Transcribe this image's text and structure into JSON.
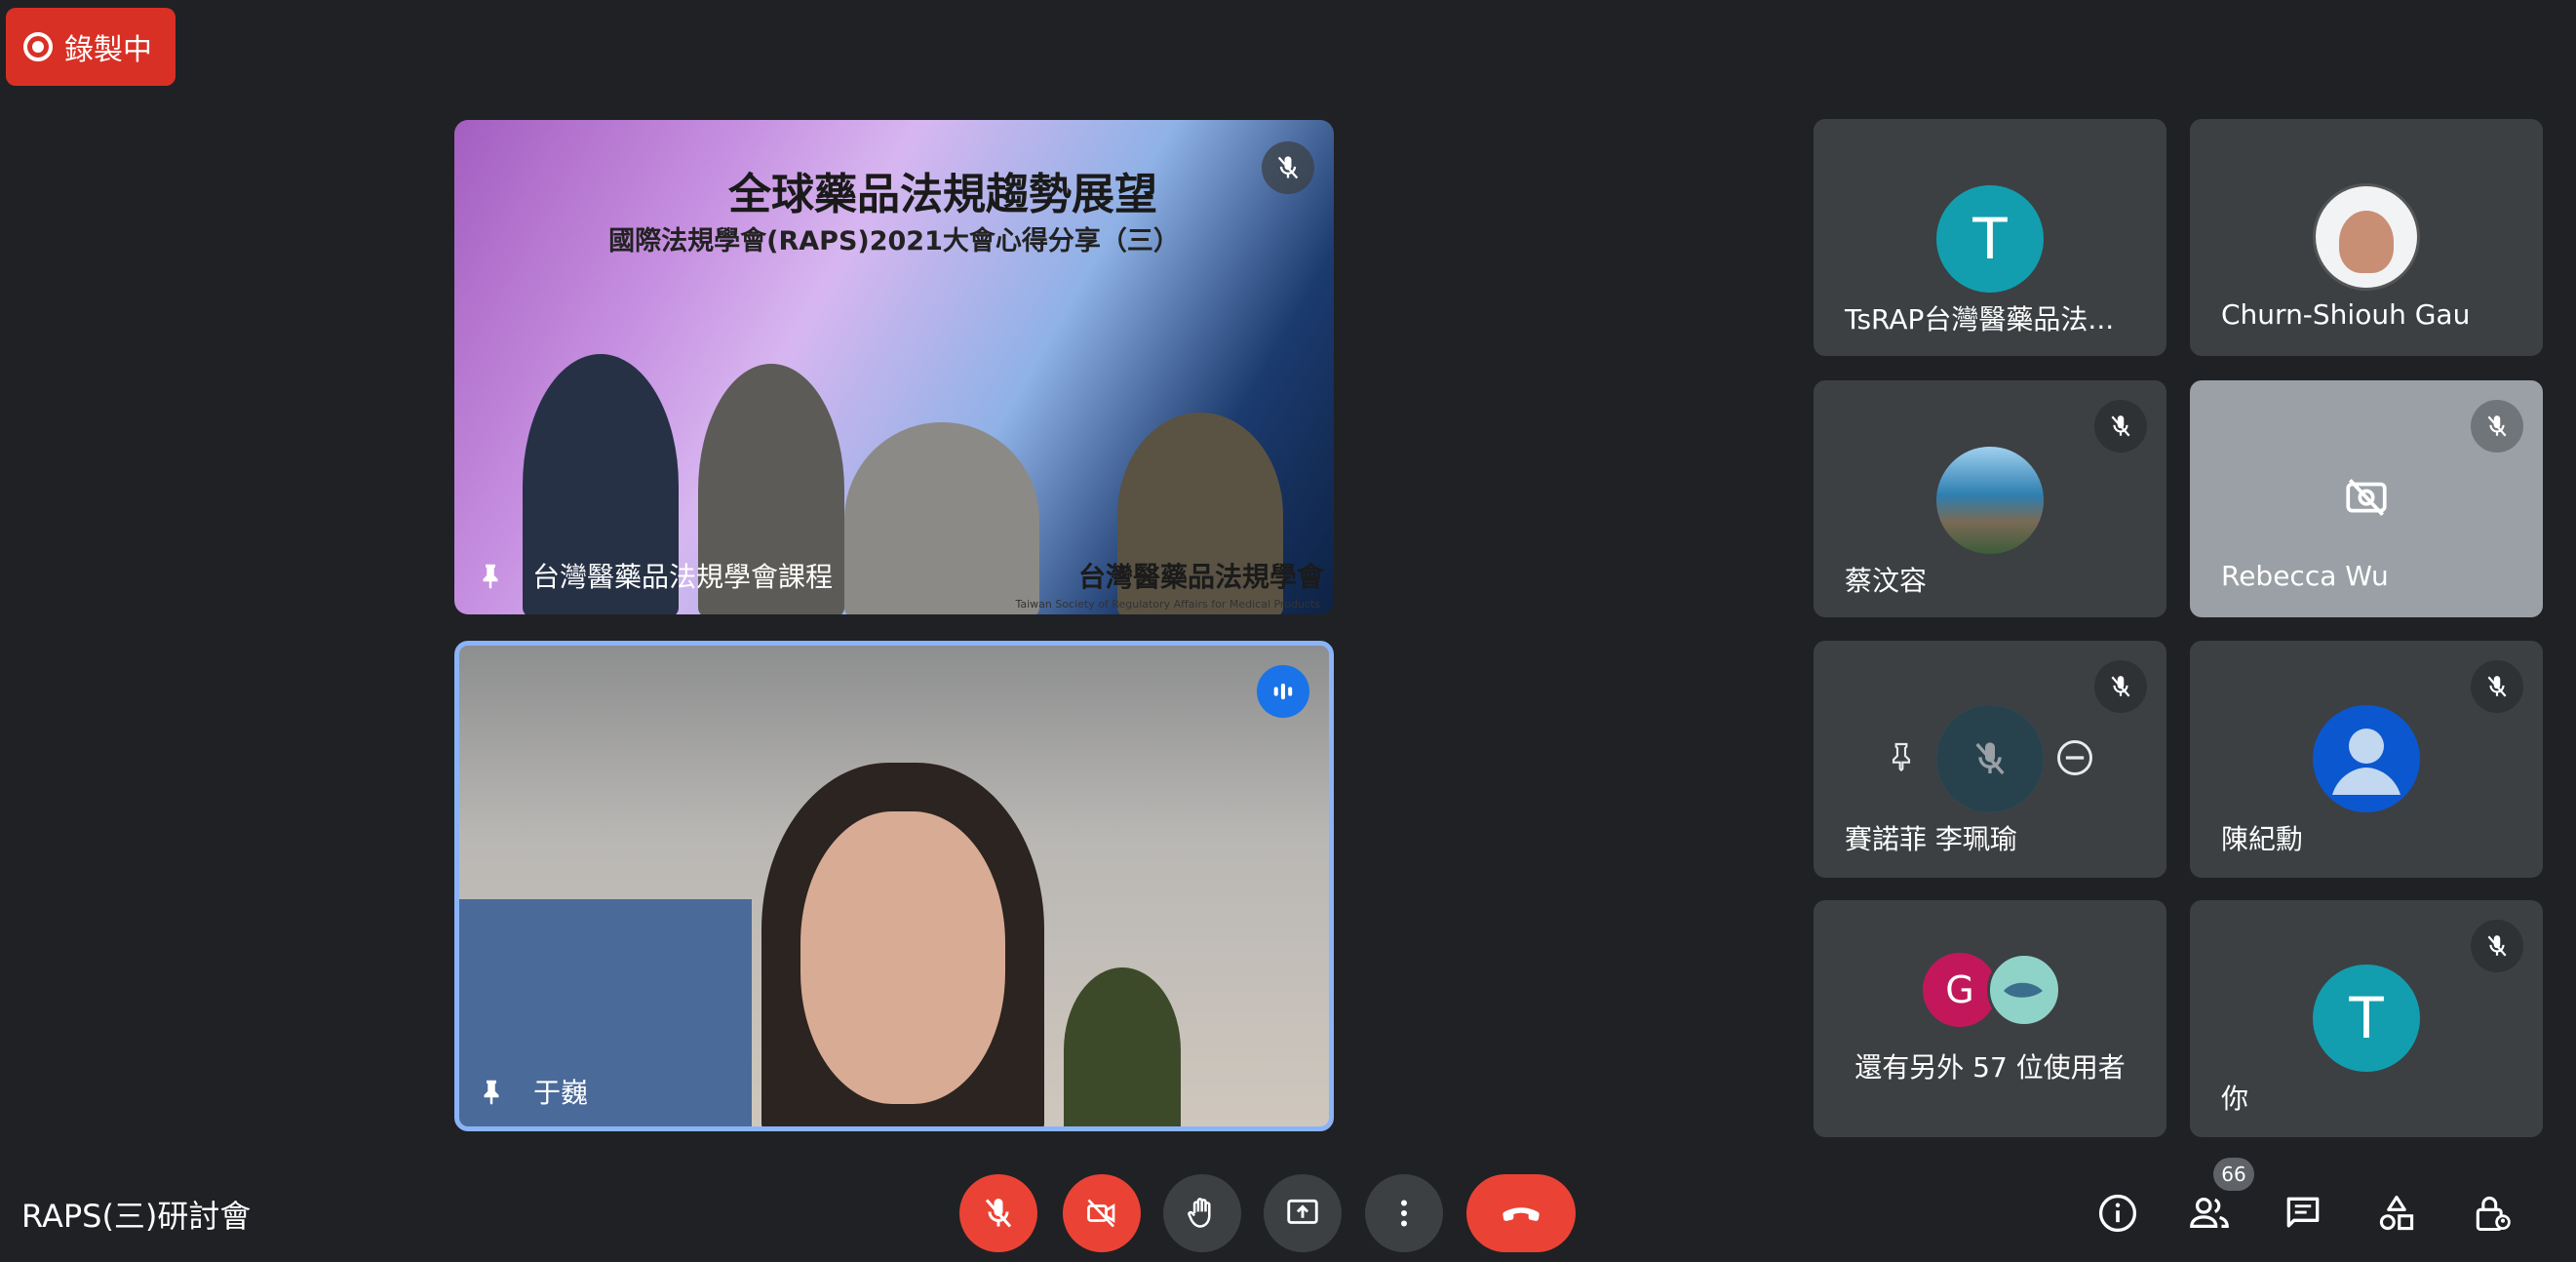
{
  "recording": {
    "label": "錄製中"
  },
  "presentation": {
    "slide_title": "全球藥品法規趨勢展望",
    "slide_subtitle": "國際法規學會(RAPS)2021大會心得分享（三）",
    "org_name": "台灣醫藥品法規學會",
    "org_name_en": "Taiwan Society of Regulatory Affairs for Medical Products",
    "tile_name": "台灣醫藥品法規學會課程"
  },
  "speaker": {
    "name": "于巍"
  },
  "participants": [
    {
      "name": "TsRAP台灣醫藥品法...",
      "initial": "T",
      "avatar_color": "#129eaf",
      "muted": false
    },
    {
      "name": "Churn-Shiouh Gau",
      "initial": "",
      "avatar_color": "#f1f3f4",
      "muted": false
    },
    {
      "name": "蔡汶容",
      "initial": "",
      "avatar_color": "#7fb6d6",
      "muted": true
    },
    {
      "name": "Rebecca Wu",
      "initial": "",
      "avatar_color": "#9aa0a6",
      "muted": true,
      "camera_off": true
    },
    {
      "name": "賽諾菲 李珮瑜",
      "initial": "",
      "avatar_color": "#3d8fb0",
      "muted": true
    },
    {
      "name": "陳紀勳",
      "initial": "",
      "avatar_color": "#0b57d0",
      "muted": true
    },
    {
      "name": "還有另外 57 位使用者",
      "initial": "G",
      "avatar_color": "#c2185b"
    },
    {
      "name": "你",
      "initial": "T",
      "avatar_color": "#129eaf",
      "muted": true
    }
  ],
  "meeting": {
    "title": "RAPS(三)研討會"
  },
  "people_count": "66",
  "icons": {
    "mic": "mic-off-icon",
    "cam": "videocam-off-icon",
    "hand": "raise-hand-icon",
    "present": "present-screen-icon",
    "more": "more-vert-icon",
    "end": "call-end-icon",
    "info": "info-icon",
    "people": "people-icon",
    "chat": "chat-icon",
    "activities": "activities-icon",
    "host": "host-controls-icon"
  }
}
